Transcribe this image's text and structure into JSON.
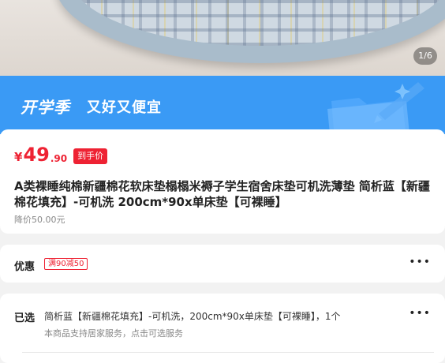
{
  "gallery": {
    "counter": "1/6"
  },
  "banner": {
    "title": "开学季",
    "subtitle": "又好又便宜"
  },
  "price": {
    "currency": "¥",
    "integer": "49",
    "decimal": ".90",
    "tag": "到手价",
    "color": "#ee2233"
  },
  "product": {
    "title": "A类裸睡纯棉新疆棉花软床垫榻榻米褥子学生宿舍床垫可机洗薄垫 简析蓝【新疆棉花填充】-可机洗 200cm*90x单床垫【可裸睡】",
    "original_price": "降价50.00元"
  },
  "discount": {
    "label": "优惠",
    "coupon": "满90减50",
    "more": "•••"
  },
  "selected": {
    "label": "已选",
    "value": "简析蓝【新疆棉花填充】-可机洗，200cm*90x单床垫【可裸睡】，1个",
    "service": "本商品支持居家服务，点击可选服务",
    "more": "•••"
  },
  "colors": {
    "banner_blue": "#3a9af5",
    "accent_red": "#ee2233",
    "background": "#f2f2f2"
  }
}
